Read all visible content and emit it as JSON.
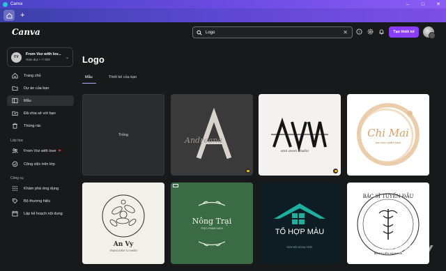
{
  "window": {
    "title": "Canva"
  },
  "header": {
    "logo": "Canva",
    "search_value": "Logo",
    "create_button": "Tạo thiết kế"
  },
  "sidebar": {
    "team_name": "From Voz with lov...",
    "team_sub": "Giáo dục • ⚇ 820",
    "team_initials": "FV",
    "items": [
      {
        "label": "Trang chủ",
        "icon": "home-icon"
      },
      {
        "label": "Dự án của bạn",
        "icon": "folder-icon"
      },
      {
        "label": "Mẫu",
        "icon": "templates-icon"
      },
      {
        "label": "Đã chia sẻ với bạn",
        "icon": "shared-icon"
      },
      {
        "label": "Thùng rác",
        "icon": "trash-icon"
      }
    ],
    "class_section": "Lớp học",
    "class_items": [
      {
        "label": "From Voz with love",
        "icon": "people-icon"
      },
      {
        "label": "Công việc trên lớp",
        "icon": "classwork-icon"
      }
    ],
    "tools_section": "Công cụ",
    "tool_items": [
      {
        "label": "Khám phá ứng dụng",
        "icon": "apps-icon"
      },
      {
        "label": "Bộ thương hiệu",
        "icon": "brand-icon"
      },
      {
        "label": "Lập kế hoạch nội dung",
        "icon": "calendar-icon"
      }
    ]
  },
  "main": {
    "title": "Logo",
    "tabs": [
      "Mẫu",
      "Thiết kế của bạn"
    ],
    "empty_card": "Trống",
    "templates": [
      {
        "name": "Andreana",
        "letter": "A"
      },
      {
        "name": "ann avon studio",
        "letters": "AAW"
      },
      {
        "name": "Chi Mai",
        "sub": "bán thực phẩm sạch"
      },
      {
        "name": "An Vy",
        "sub": "TRANG ĐIỂM TỰ NHIÊN"
      },
      {
        "name": "Nông Trại",
        "sub": "THỰC PHẨM SẠCH"
      },
      {
        "name": "TỔ HỢP MÀU",
        "sub": "SƠN NỘI NGOẠI THẤT"
      },
      {
        "name": "BÁC SĨ TUYẾN ĐẦU",
        "sub": "BỆNH VIỆN ĐA KHOA"
      }
    ]
  },
  "colors": {
    "accent": "#8b3dff",
    "background": "#18191b",
    "card": "#2b2c30"
  },
  "watermark": "Webuy"
}
